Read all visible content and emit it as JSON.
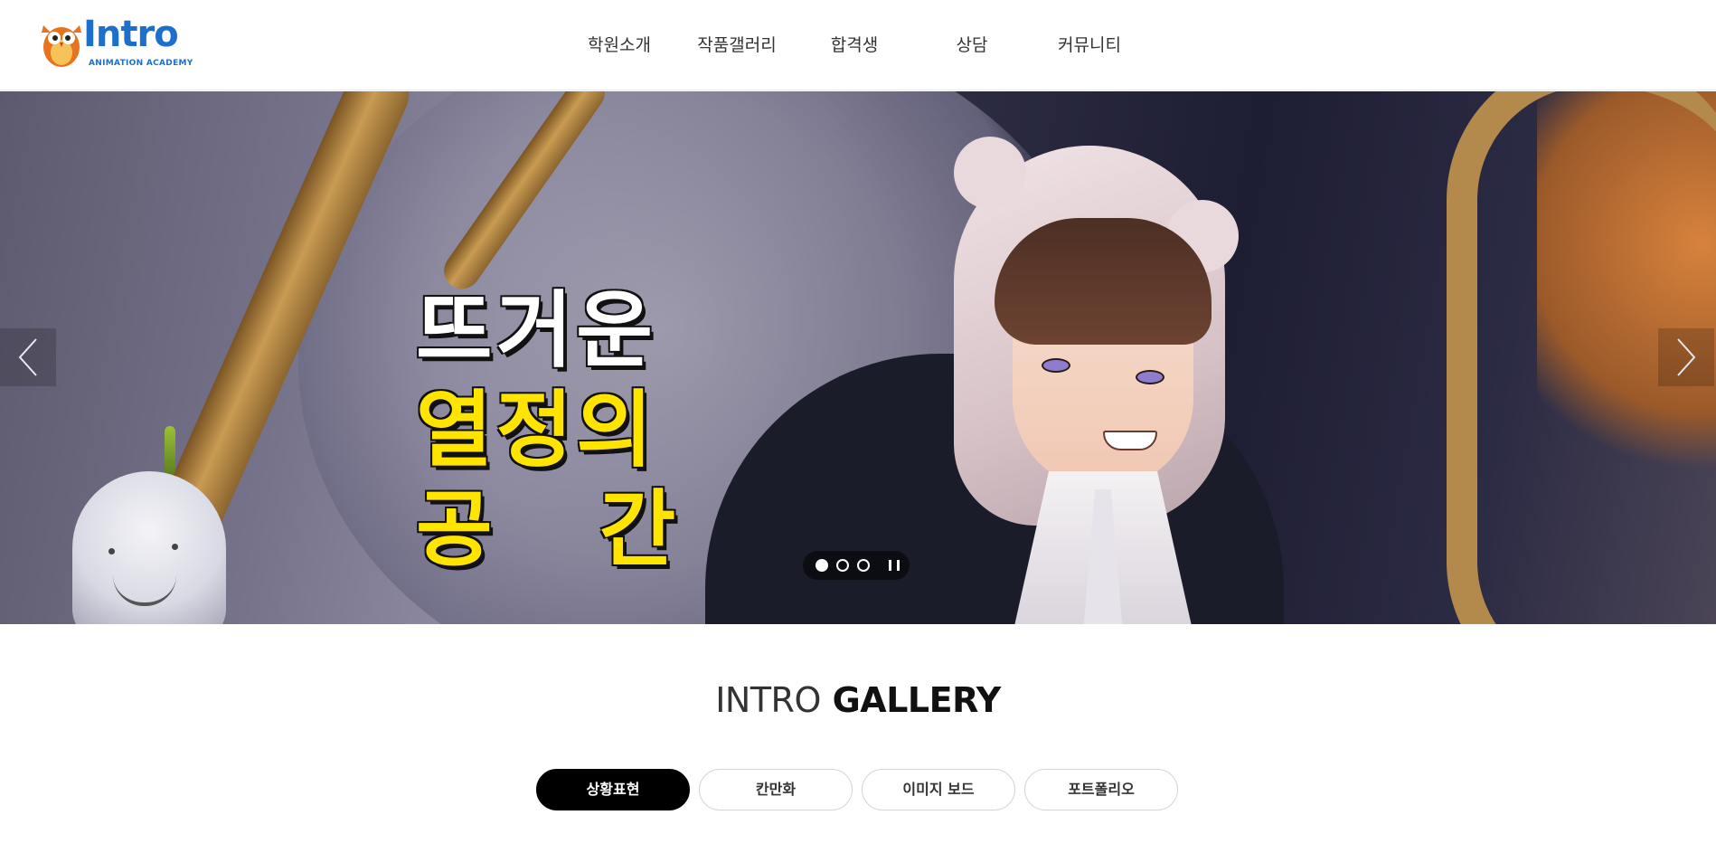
{
  "header": {
    "logo_text": "Intro",
    "logo_sub": "ANIMATION ACADEMY",
    "nav": [
      "학원소개",
      "작품갤러리",
      "합격생",
      "상담",
      "커뮤니티"
    ]
  },
  "hero": {
    "headline": [
      "뜨거운",
      "열정의",
      "공간"
    ],
    "slides_total": 3,
    "active_slide": 1,
    "icons": {
      "prev": "chevron-left-icon",
      "next": "chevron-right-icon",
      "pause": "pause-icon"
    }
  },
  "gallery": {
    "title_light": "INTRO",
    "title_bold": "GALLERY",
    "tabs": [
      "상황표현",
      "칸만화",
      "이미지 보드",
      "포트폴리오"
    ],
    "active_tab": 0
  },
  "colors": {
    "logo_blue": "#1e6fc9",
    "logo_red": "#e8312f",
    "headline_yellow": "#ffe400",
    "active_tab_bg": "#000000"
  }
}
